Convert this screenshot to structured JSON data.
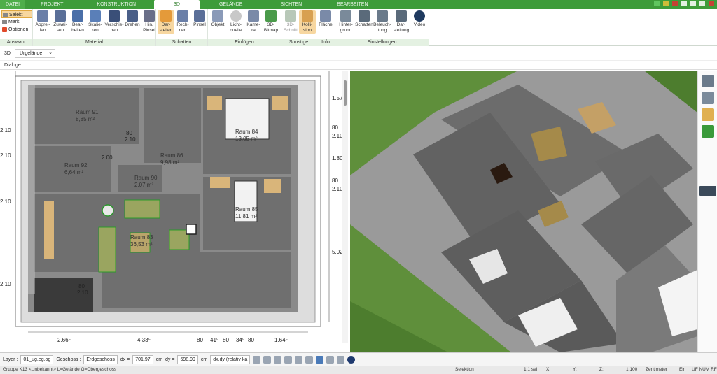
{
  "menubar": {
    "tabs": [
      "DATEI",
      "PROJEKT",
      "KONSTRUKTION",
      "3D",
      "GELÄNDE",
      "SICHTEN",
      "BEARBEITEN"
    ],
    "active": "3D"
  },
  "ribbon": {
    "auswahl": {
      "title": "Auswahl",
      "selekt": "Selekt",
      "mark": "Mark.",
      "optionen": "Optionen"
    },
    "material": {
      "title": "Material",
      "buttons": [
        "Abgrei-\nfen",
        "Zuwei-\nsen",
        "Bear-\nbeiten",
        "Skalie-\nren",
        "Verschie-\nben",
        "Drehen",
        "Hin.\nPinsel"
      ]
    },
    "schatten": {
      "title": "Schatten",
      "buttons": [
        "Dar-\nstellen",
        "Rech-\nnen",
        "Pinsel"
      ]
    },
    "einfuegen": {
      "title": "Einfügen",
      "buttons": [
        "Objekt",
        "Licht-\nquelle",
        "Kame-\nra",
        "3D-\nBitmap"
      ]
    },
    "sonstige": {
      "title": "Sonstige",
      "buttons": [
        "3D-\nSchnitt",
        "Kolli-\nsion"
      ]
    },
    "info": {
      "title": "Info",
      "buttons": [
        "Fläche"
      ]
    },
    "einstellungen": {
      "title": "Einstellungen",
      "buttons": [
        "Hinter-\ngrund",
        "Schatten",
        "Beleuch-\ntung",
        "Dar-\nstellung",
        "Video"
      ]
    }
  },
  "view_bar": {
    "mode": "3D",
    "layer": "Urgelände"
  },
  "dialoge_label": "Dialoge:",
  "plan": {
    "rooms": [
      {
        "name": "Raum 91",
        "area": "8,85 m²"
      },
      {
        "name": "Raum 92",
        "area": "6,64 m²"
      },
      {
        "name": "Raum 90",
        "area": "2,07 m²"
      },
      {
        "name": "Raum 86",
        "area": "9,98 m²"
      },
      {
        "name": "Raum 84",
        "area": "13,05 m²"
      },
      {
        "name": "Raum 85",
        "area": "11,81 m²"
      },
      {
        "name": "Raum 83",
        "area": "36,53 m²"
      }
    ],
    "dims_bottom": [
      "2.66⁵",
      "4.33⁵",
      "80",
      "41⁵",
      "80",
      "34⁵",
      "80",
      "1.64⁵"
    ],
    "dims_right": [
      "1.57⁵",
      "80",
      "2.10",
      "1.80",
      "80",
      "2.10",
      "5.02⁵"
    ],
    "dims_left": [
      "2.10",
      "2.10",
      "2.10",
      "2.10"
    ],
    "door_labels": [
      "80",
      "2.10",
      "2.00",
      "80",
      "2.00",
      "80",
      "2.10"
    ]
  },
  "statusbar": {
    "layer_label": "Layer :",
    "layer_value": "01_ug,eg,og",
    "geschoss_label": "Geschoss :",
    "geschoss_value": "Erdgeschoss",
    "dx_label": "dx =",
    "dx_value": "701,97",
    "dy_label": "dy =",
    "dy_value": "698,99",
    "unit": "cm",
    "mode": "dx,dy (relativ ka"
  },
  "infobar": {
    "group": "Gruppe K13 <Unbekannt> L=Gelände G=Obergeschoss",
    "state": "Selektion",
    "scale": "1:1 sel",
    "x": "X:",
    "y": "Y:",
    "z": "Z:",
    "ratio": "1:100",
    "units": "Zentimeter",
    "ein": "Ein",
    "flags": "UF NUM RF"
  }
}
